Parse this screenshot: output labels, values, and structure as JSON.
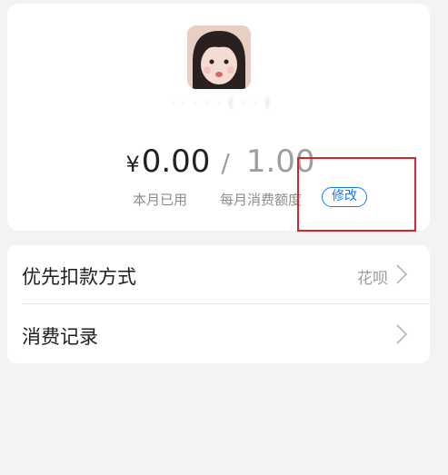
{
  "profile": {
    "nickname": "· · · ·  ·  ( · · )"
  },
  "summary": {
    "currency_symbol": "¥",
    "used_amount": "0.00",
    "separator": "/",
    "monthly_quota": "1.00",
    "used_label": "本月已用",
    "quota_label": "每月消费额度",
    "modify_label": "修改"
  },
  "list": {
    "items": [
      {
        "label": "优先扣款方式",
        "value": "花呗"
      },
      {
        "label": "消费记录",
        "value": ""
      }
    ]
  },
  "colors": {
    "accent": "#1677ff",
    "highlight": "#d6252b",
    "background": "#f3f3f3"
  }
}
